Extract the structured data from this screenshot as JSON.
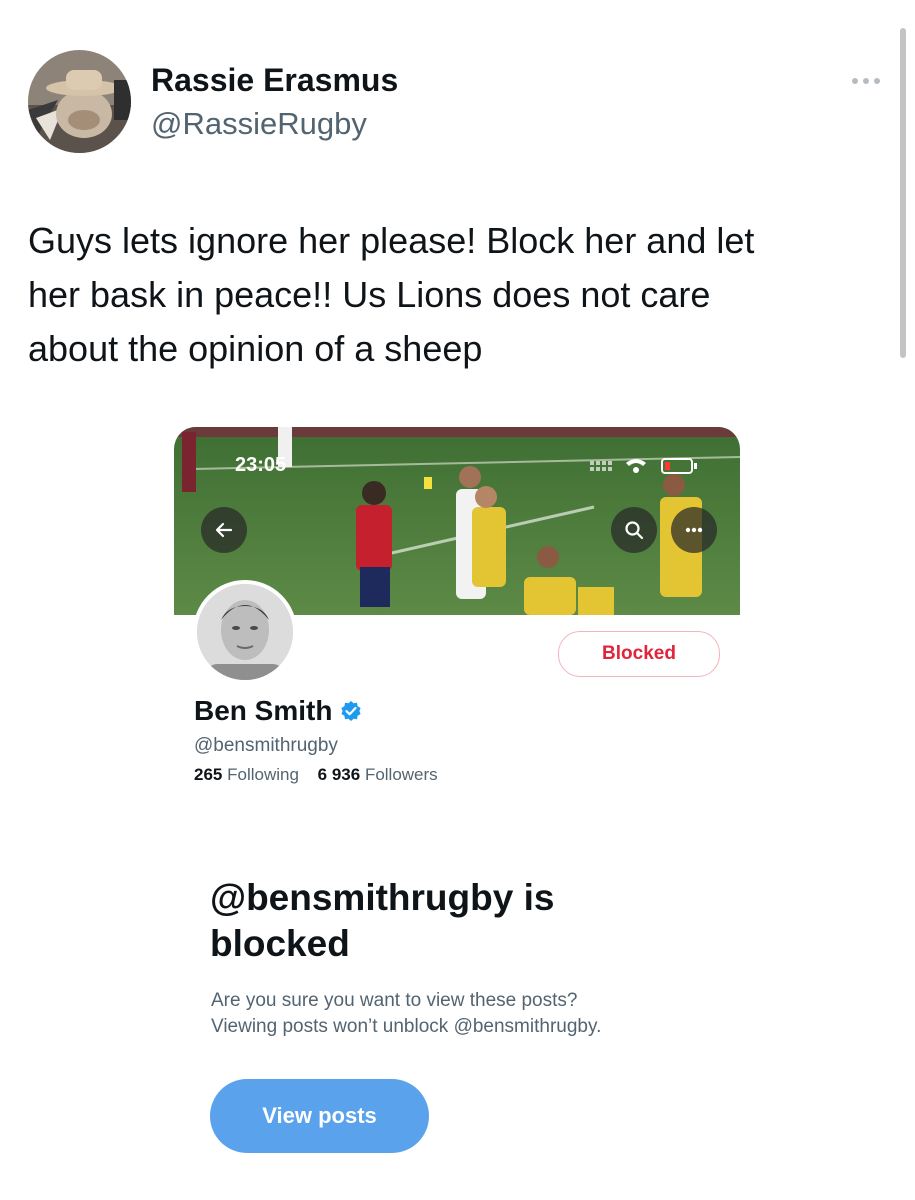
{
  "tweet": {
    "author_name": "Rassie Erasmus",
    "author_handle": "@RassieRugby",
    "text_lines": [
      "Guys lets ignore her please! Block her and let",
      "her bask in peace!! Us Lions does not care",
      "about the opinion of a sheep"
    ]
  },
  "embedded_screenshot": {
    "status_time": "23:05",
    "profile": {
      "name": "Ben Smith",
      "handle": "@bensmithrugby",
      "following_count": "265",
      "following_label": "Following",
      "followers_count": "6 936",
      "followers_label": "Followers",
      "blocked_button": "Blocked"
    },
    "blocked_notice": {
      "title": "@bensmithrugby is blocked",
      "description_lines": [
        "Are you sure you want to view these posts?",
        "Viewing posts won’t unblock @bensmithrugby."
      ],
      "view_posts_button": "View posts"
    }
  },
  "colors": {
    "verified_badge": "#1d9bf0",
    "blocked_red": "#e0243b",
    "view_posts_blue": "#5aa3ec"
  }
}
